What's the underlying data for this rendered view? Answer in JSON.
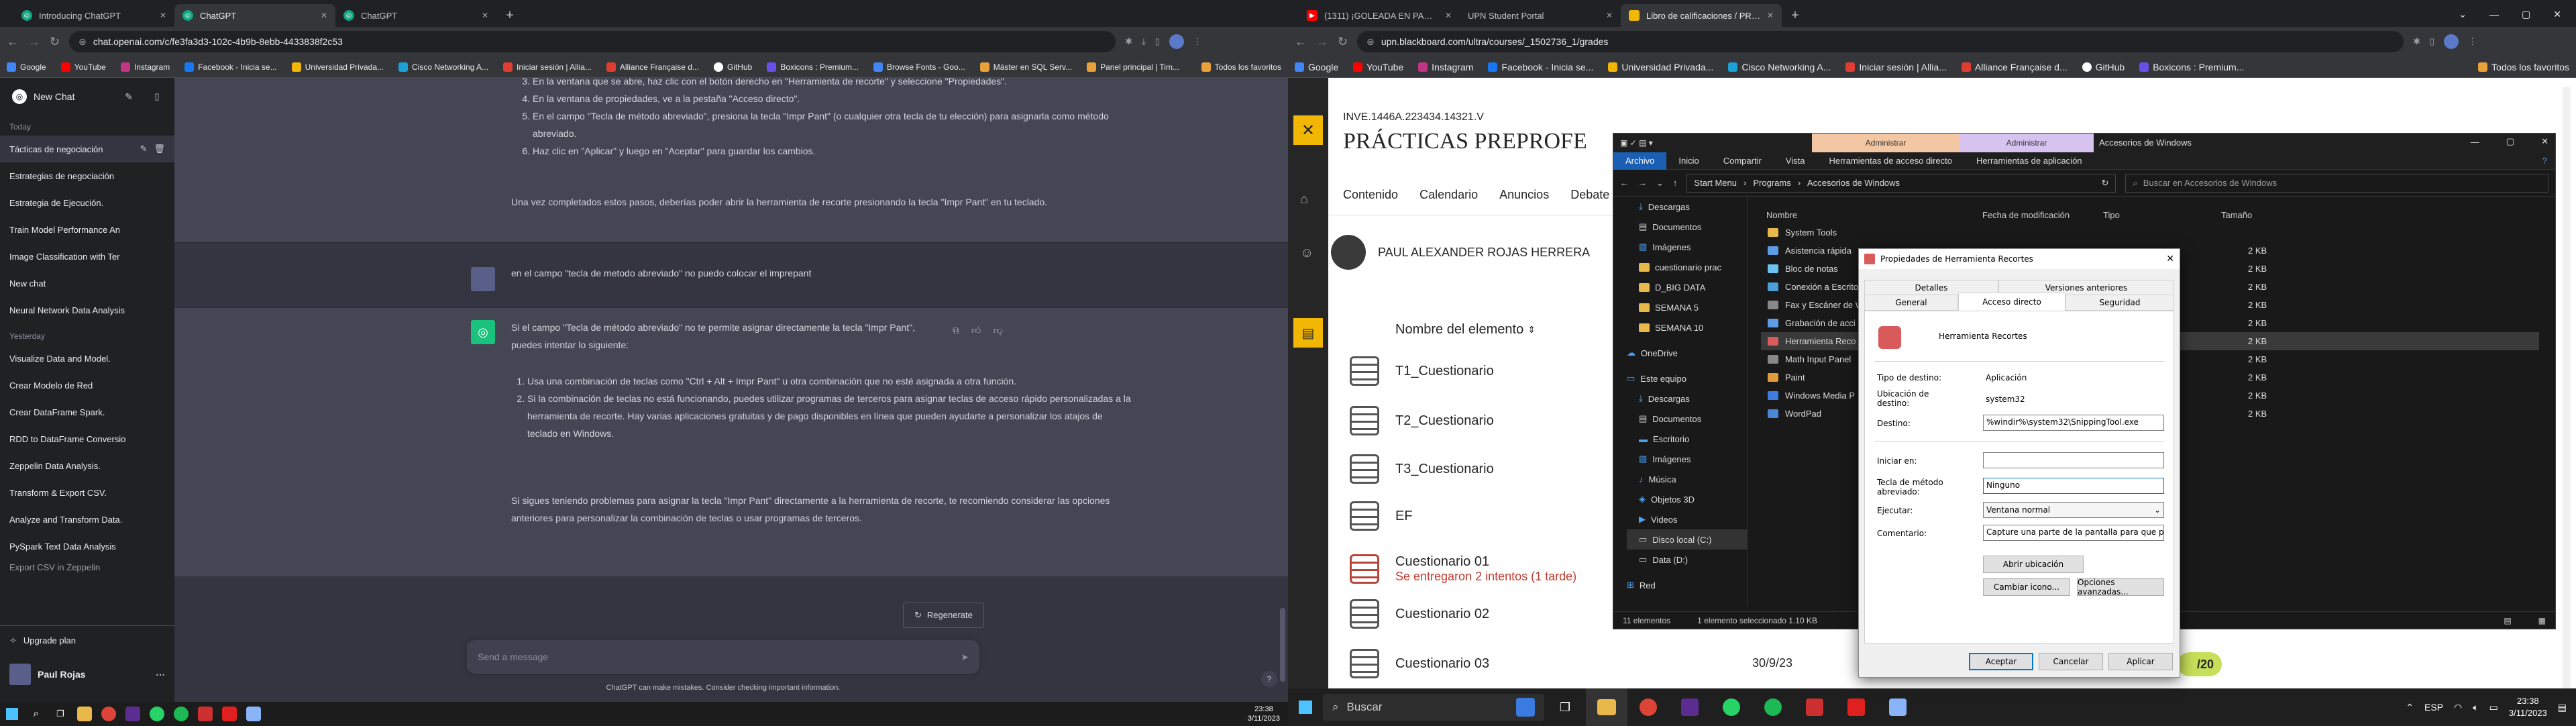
{
  "left_browser": {
    "tabs": [
      {
        "title": "Introducing ChatGPT",
        "active": false
      },
      {
        "title": "ChatGPT",
        "active": true
      },
      {
        "title": "ChatGPT",
        "active": false
      }
    ],
    "url": "chat.openai.com/c/fe3fa3d3-102c-4b9b-8ebb-4433838f2c53",
    "bookmarks": [
      "Google",
      "YouTube",
      "Instagram",
      "Facebook - Inicia se...",
      "Universidad Privada...",
      "Cisco Networking A...",
      "Iniciar sesión | Allia...",
      "Alliance Française d...",
      "GitHub",
      "Boxicons : Premium...",
      "Browse Fonts - Goo...",
      "Máster en SQL Serv...",
      "Panel principal | Tim..."
    ],
    "all_bookmarks": "Todos los favoritos"
  },
  "chatgpt": {
    "new_chat": "New Chat",
    "groups": [
      {
        "label": "Today",
        "items": [
          "Tácticas de negociación",
          "Estrategias de negociación",
          "Estrategia de Ejecución.",
          "Train Model Performance An",
          "Image Classification with Ter",
          "New chat",
          "Neural Network Data Analysis"
        ]
      },
      {
        "label": "Yesterday",
        "items": [
          "Visualize Data and Model.",
          "Crear Modelo de Red",
          "Crear DataFrame Spark.",
          "RDD to DataFrame Conversio",
          "Zeppelin Data Analysis.",
          "Transform & Export CSV.",
          "Analyze and Transform Data.",
          "PySpark Text Data Analysis",
          "Export CSV in Zeppelin"
        ]
      }
    ],
    "upgrade": "Upgrade plan",
    "user_name": "Paul Rojas",
    "prev_steps": [
      "En la ventana que se abre, haz clic con el botón derecho en \"Herramienta de recorte\" y seleccione \"Propiedades\".",
      "En la ventana de propiedades, ve a la pestaña \"Acceso directo\".",
      "En el campo \"Tecla de método abreviado\", presiona la tecla \"Impr Pant\" (o cualquier otra tecla de tu elección) para asignarla como método abreviado.",
      "Haz clic en \"Aplicar\" y luego en \"Aceptar\" para guardar los cambios."
    ],
    "prev_steps_start": 3,
    "prev_closing": "Una vez completados estos pasos, deberías poder abrir la herramienta de recorte presionando la tecla \"Impr Pant\" en tu teclado.",
    "user_message": "en el campo  \"tecla de metodo abreviado\" no puedo colocar el imprepant",
    "ai_intro": "Si el campo \"Tecla de método abreviado\" no te permite asignar directamente la tecla \"Impr Pant\", puedes intentar lo siguiente:",
    "ai_steps": [
      "Usa una combinación de teclas como \"Ctrl + Alt + Impr Pant\" u otra combinación que no esté asignada a otra función.",
      "Si la combinación de teclas no está funcionando, puedes utilizar programas de terceros para asignar teclas de acceso rápido personalizadas a la herramienta de recorte. Hay varias aplicaciones gratuitas y de pago disponibles en línea que pueden ayudarte a personalizar los atajos de teclado en Windows."
    ],
    "ai_closing": "Si sigues teniendo problemas para asignar la tecla \"Impr Pant\" directamente a la herramienta de recorte, te recomiendo considerar las opciones anteriores para personalizar la combinación de teclas o usar programas de terceros.",
    "regenerate": "Regenerate",
    "input_placeholder": "Send a message",
    "disclaimer": "ChatGPT can make mistakes. Consider checking important information."
  },
  "right_browser": {
    "tabs": [
      {
        "title": "(1311) ¡GOLEADA EN PARÍS PAR",
        "active": false
      },
      {
        "title": "UPN Student Portal",
        "active": false
      },
      {
        "title": "Libro de calificaciones / PRÁCTI",
        "active": true
      }
    ],
    "url": "upn.blackboard.com/ultra/courses/_1502736_1/grades",
    "bookmarks": [
      "Google",
      "YouTube",
      "Instagram",
      "Facebook - Inicia se...",
      "Universidad Privada...",
      "Cisco Networking A...",
      "Iniciar sesión | Allia...",
      "Alliance Française d...",
      "GitHub",
      "Boxicons : Premium..."
    ],
    "all_bookmarks": "Todos los favoritos"
  },
  "blackboard": {
    "course_code": "INVE.1446A.223434.14321.V",
    "course_title": "PRÁCTICAS PREPROFE",
    "nav": [
      "Contenido",
      "Calendario",
      "Anuncios",
      "Debate"
    ],
    "student": "PAUL ALEXANDER ROJAS HERRERA",
    "column_header": "Nombre del elemento",
    "items": [
      {
        "name": "T1_Cuestionario",
        "sub": "",
        "date": "",
        "score": ""
      },
      {
        "name": "T2_Cuestionario",
        "sub": "",
        "date": "",
        "score": ""
      },
      {
        "name": "T3_Cuestionario",
        "sub": "",
        "date": "",
        "score": ""
      },
      {
        "name": "EF",
        "sub": "",
        "date": "",
        "score": ""
      },
      {
        "name": "Cuestionario 01",
        "sub": "Se entregaron 2 intentos (1 tarde)",
        "date": "",
        "score": ""
      },
      {
        "name": "Cuestionario 02",
        "sub": "",
        "date": "",
        "score": ""
      },
      {
        "name": "Cuestionario 03",
        "sub": "",
        "date": "30/9/23",
        "score": "/20"
      }
    ]
  },
  "explorer": {
    "ribbon_groups": [
      "Administrar",
      "Administrar"
    ],
    "title": "Accesorios de Windows",
    "ribbon_tabs": [
      "Archivo",
      "Inicio",
      "Compartir",
      "Vista",
      "Herramientas de acceso directo",
      "Herramientas de aplicación"
    ],
    "path": [
      "Start Menu",
      "Programs",
      "Accesorios de Windows"
    ],
    "search_placeholder": "Buscar en Accesorios de Windows",
    "tree": [
      "Descargas",
      "Documentos",
      "Imágenes",
      "cuestionario prac",
      "D_BIG DATA",
      "SEMANA 5",
      "SEMANA 10",
      "OneDrive",
      "Este equipo",
      "Descargas",
      "Documentos",
      "Escritorio",
      "Imágenes",
      "Música",
      "Objetos 3D",
      "Videos",
      "Disco local (C:)",
      "Data (D:)",
      "Red"
    ],
    "columns": [
      "Nombre",
      "Fecha de modificación",
      "Tipo",
      "Tamaño"
    ],
    "files": [
      {
        "name": "System Tools",
        "size": ""
      },
      {
        "name": "Asistencia rápida",
        "size": "2 KB"
      },
      {
        "name": "Bloc de notas",
        "size": "2 KB"
      },
      {
        "name": "Conexión a Escrito",
        "size": "2 KB"
      },
      {
        "name": "Fax y Escáner de W",
        "size": "2 KB"
      },
      {
        "name": "Grabación de acci",
        "size": "2 KB"
      },
      {
        "name": "Herramienta Reco",
        "size": "2 KB"
      },
      {
        "name": "Math Input Panel",
        "size": "2 KB"
      },
      {
        "name": "Paint",
        "size": "2 KB"
      },
      {
        "name": "Windows Media P",
        "size": "2 KB"
      },
      {
        "name": "WordPad",
        "size": "2 KB"
      }
    ],
    "status_items": "11 elementos",
    "status_selected": "1 elemento seleccionado  1.10 KB"
  },
  "dialog": {
    "title": "Propiedades de Herramienta Recortes",
    "tabs_row1": [
      "Detalles",
      "Versiones anteriores"
    ],
    "tabs_row2": [
      "General",
      "Acceso directo",
      "Seguridad"
    ],
    "app_name": "Herramienta Recortes",
    "target_type_label": "Tipo de destino:",
    "target_type": "Aplicación",
    "target_location_label": "Ubicación de destino:",
    "target_location": "system32",
    "target_label": "Destino:",
    "target": "%windir%\\system32\\SnippingTool.exe",
    "start_in_label": "Iniciar en:",
    "start_in": "",
    "shortcut_key_label": "Tecla de método abreviado:",
    "shortcut_key": "Ninguno",
    "run_label": "Ejecutar:",
    "run": "Ventana normal",
    "comment_label": "Comentario:",
    "comment": "Capture una parte de la pantalla para que pueda g",
    "open_location": "Abrir ubicación",
    "change_icon": "Cambiar icono...",
    "advanced": "Opciones avanzadas...",
    "ok": "Aceptar",
    "cancel": "Cancelar",
    "apply": "Aplicar"
  },
  "taskbar": {
    "search": "Buscar",
    "left_time": "23:38",
    "left_date": "3/11/2023",
    "right_time": "23:38",
    "right_date": "3/11/2023",
    "lang": "ESP"
  }
}
